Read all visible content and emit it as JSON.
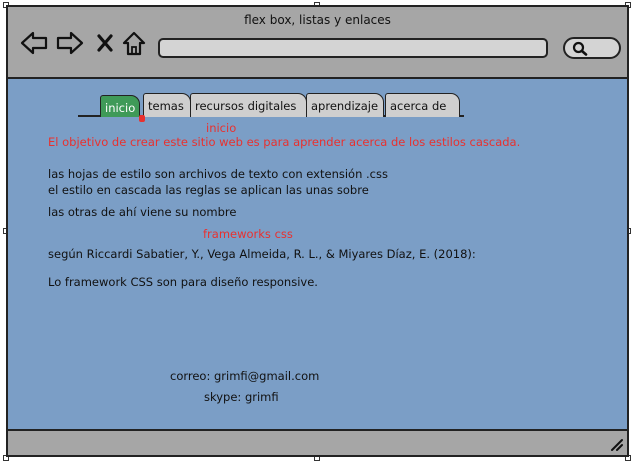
{
  "window": {
    "title": "flex box, listas y enlaces"
  },
  "toolbar": {
    "icons": [
      "back-arrow-icon",
      "forward-arrow-icon",
      "close-x-icon",
      "home-icon",
      "search-icon"
    ],
    "url_value": ""
  },
  "tabs": [
    {
      "label": "inicio",
      "active": true
    },
    {
      "label": "temas",
      "active": false
    },
    {
      "label": "recursos digitales",
      "active": false
    },
    {
      "label": "aprendizaje",
      "active": false
    },
    {
      "label": "acerca de",
      "active": false
    }
  ],
  "content": {
    "heading_inicio": "inicio",
    "objective": "El objetivo de crear este sitio web es para aprender acerca de los estilos cascada.",
    "line1": "las hojas de estilo son archivos de texto con extensión .css",
    "line2": "el estilo en cascada las reglas se aplican las unas sobre",
    "line3": " las otras de ahí viene su nombre",
    "heading_frameworks": "frameworks css",
    "citation": "según Riccardi Sabatier, Y., Vega Almeida, R. L., & Miyares Díaz, E. (2018):",
    "framework_text": "Lo framework CSS son para diseño responsive.",
    "email": "correo: grimfi@gmail.com",
    "skype": "skype: grimfi"
  },
  "colors": {
    "page_background": "#7b9ec6",
    "chrome": "#a6a6a6",
    "active_tab": "#3f9a58",
    "accent_red": "#e8312f"
  }
}
